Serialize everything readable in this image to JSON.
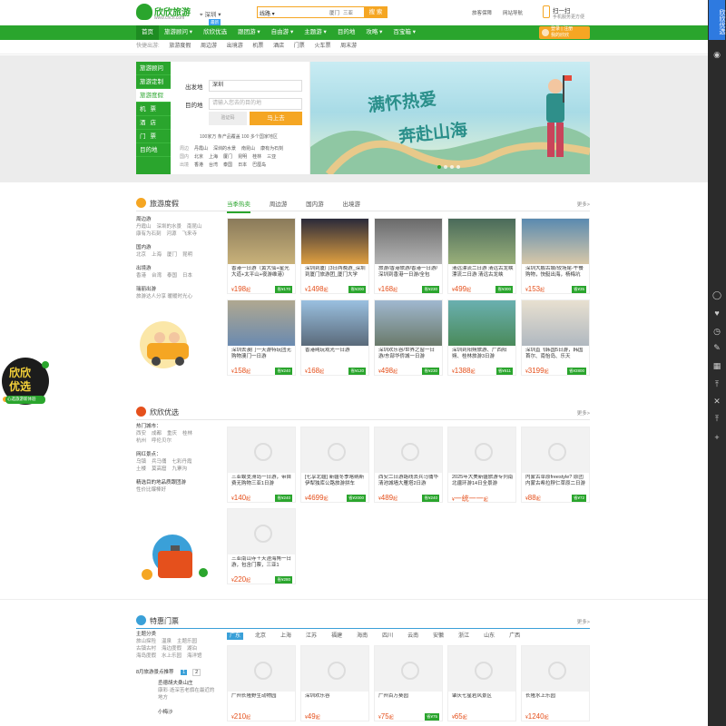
{
  "header": {
    "logo_text": "欣欣旅游",
    "logo_sub": "www.cncn.com",
    "city": "深圳",
    "search_type": "线路",
    "search_tags": [
      "厦门",
      "三亚"
    ],
    "search_button": "搜 索",
    "links": [
      "旅客保障",
      "网站导航"
    ],
    "scan_title": "扫一扫",
    "scan_sub": "手机服务更方便"
  },
  "nav": {
    "items": [
      "首页",
      "旅游顾问",
      "欣欣优选",
      "跟团游",
      "自由游",
      "主题游",
      "目的地",
      "攻略",
      "百宝箱"
    ],
    "badge": "最新",
    "login": "登录 | 注册",
    "login_sub": "我的欣欣"
  },
  "quick": {
    "label": "快捷出游:",
    "items": [
      "旅游度假",
      "周边游",
      "出境游",
      "机票",
      "酒店",
      "门票",
      "火车票",
      "周末游"
    ]
  },
  "hero": {
    "side_menu": [
      "旅游顾问",
      "旅游定制",
      "旅游度假",
      "机票",
      "酒店",
      "门票",
      "目的地"
    ],
    "from_label": "出发地",
    "from_value": "深圳",
    "to_label": "目的地",
    "to_placeholder": "请输入您去的目的地",
    "captcha_text": "验证码",
    "go_button": "马上去",
    "stats": "100家万 条产品覆盖 100 多个国家地区",
    "hot": [
      {
        "k": "周边",
        "v": [
          "丹霞山",
          "深圳的水景",
          "南昆山",
          "康有为石刻"
        ]
      },
      {
        "k": "国内",
        "v": [
          "北京",
          "上海",
          "厦门",
          "昆明",
          "桂林",
          "三亚"
        ]
      },
      {
        "k": "出境",
        "v": [
          "香港",
          "台湾",
          "泰国",
          "日本",
          "巴厘岛"
        ]
      }
    ],
    "banner_line1": "满怀热爱",
    "banner_line2": "奔赴山海"
  },
  "tours": {
    "title": "旅游度假",
    "tabs": [
      "当季热卖",
      "周边游",
      "国内游",
      "出境游"
    ],
    "more": "更多>",
    "filters": [
      {
        "h": "周边游",
        "v": [
          "丹霞山",
          "深圳的水景",
          "南昆山",
          "康有为石刻",
          "河源",
          "飞来寺"
        ]
      },
      {
        "h": "国内游",
        "v": [
          "北京",
          "上海",
          "厦门",
          "昆明"
        ]
      },
      {
        "h": "出境游",
        "v": [
          "香港",
          "台湾",
          "泰国",
          "日本"
        ]
      },
      {
        "h": "瑞丽出游",
        "v": [
          "旅游达人分享 暖暖时光心"
        ]
      }
    ],
    "cards": [
      {
        "t": "香港一日游（黄大仙+星光大道+太平山+夜游维港）",
        "p": "198",
        "s": "省¥170"
      },
      {
        "t": "深圳到厦门3日两晚游_深圳到厦门旅游团_厦门大学",
        "p": "1498",
        "s": "省¥200"
      },
      {
        "t": "旅游/香港旅游/香港一日游/深圳到香港一日游/全包",
        "p": "168",
        "s": "省¥230"
      },
      {
        "t": "清远漂流二日游 清远古龙峡漂流二日游 清远古龙峡",
        "p": "499",
        "s": "省¥300"
      },
      {
        "t": "深圳大鹏古城/较场尾-午餐购物，快艇出海，杨梅坑",
        "p": "153",
        "s": "省¥35"
      },
      {
        "t": "深圳去澳门一天游特玩团无购物澳门一日游",
        "p": "158",
        "s": "省¥240"
      },
      {
        "t": "香港纯玩观光一日游",
        "p": "168",
        "s": "省¥120"
      },
      {
        "t": "深圳欢乐谷/世界之窗一日游/东部华侨城一日游",
        "p": "498",
        "s": "省¥230"
      },
      {
        "t": "深圳到阳朔旅游、广西阳朔、桂林旅游3日游",
        "p": "1388",
        "s": "省¥611"
      },
      {
        "t": "深圳直飞韩国5日游，韩国首尔、南怡岛、乐天",
        "p": "3199",
        "s": "省¥2800"
      }
    ]
  },
  "youxuan": {
    "title": "欣欣优选",
    "more": "更多>",
    "filters": [
      {
        "h": "热门城市：",
        "v": [
          "西安",
          "成都",
          "重庆",
          "桂林",
          "杭州",
          "呼伦贝尔"
        ]
      },
      {
        "h": "网红景点：",
        "v": [
          "乌镇",
          "兵马俑",
          "七彩丹霞",
          "土楼",
          "莫高窟",
          "九寨沟"
        ]
      },
      {
        "h": "精选目的地品质跟团游",
        "v": [
          "性价比爆棒好"
        ]
      }
    ],
    "cards": [
      {
        "t": "三亚蜈支洲岛一日游，带自费无购物三亚1日游",
        "p": "140",
        "s": "省¥240"
      },
      {
        "t": "[七享北疆] 新疆冬季喀纳斯伊犁独库公路旅游拼车",
        "p": "4699",
        "s": "省¥2000"
      },
      {
        "t": "西安二日游路线去兵马俑华清池城墙大雁塔2日游",
        "p": "489",
        "s": "省¥240"
      },
      {
        "t": "2025年大美新疆旅游专列南北疆环游14日全景游",
        "p": "一统一一",
        "s": ""
      },
      {
        "t": "内蒙古草原freestyle? 原团内蒙古希拉穆仁草原二日游",
        "p": "88",
        "s": "省¥72"
      },
      {
        "t": "三亚南山寺＋天涯海角一日游，包含门票，三亚1",
        "p": "220",
        "s": "省¥280"
      }
    ]
  },
  "tickets": {
    "title": "特惠门票",
    "more": "更多>",
    "regions": [
      "广东",
      "北京",
      "上海",
      "江苏",
      "福建",
      "海南",
      "四川",
      "云南",
      "安徽",
      "浙江",
      "山东",
      "广西"
    ],
    "filters": [
      {
        "h": "主题分类",
        "v": [
          "旅山探险",
          "温泉",
          "主题乐园",
          "古镇古村",
          "海边度假",
          "湖泊",
          "海岛度假",
          "水上乐园",
          "海洋馆"
        ]
      }
    ],
    "hot_label": "8月旅游景点推荐",
    "pages": [
      "1",
      "2"
    ],
    "hot_items": [
      {
        "t": "丞德胡夫桑山庄",
        "d": "康彩·逝深苦老旗在最近的地方"
      },
      {
        "t": "小梅沙",
        "d": ""
      }
    ],
    "cards": [
      {
        "t": "广州长隆野生动物园",
        "p": "210",
        "s": ""
      },
      {
        "t": "深圳欢乐谷",
        "p": "49",
        "s": ""
      },
      {
        "t": "广州百万葵园",
        "p": "75",
        "s": "省¥75"
      },
      {
        "t": "肇庆七星岩风景区",
        "p": "65",
        "s": ""
      },
      {
        "t": "长隆水上乐园",
        "p": "1240",
        "s": ""
      }
    ]
  },
  "rbar": {
    "top": "欣欣优选",
    "icons": [
      "user-icon",
      "heart-icon",
      "clock-icon",
      "pen-icon",
      "qrcode-icon",
      "top-icon",
      "close-icon",
      "plus-icon"
    ]
  },
  "float_ad": {
    "line1": "欣欣",
    "line2": "优选",
    "tag": "心选旅游新体验"
  },
  "colors": {
    "brand": "#2aa52d",
    "accent": "#f5a623",
    "price": "#e5501c",
    "side": "#2e7ae0"
  }
}
